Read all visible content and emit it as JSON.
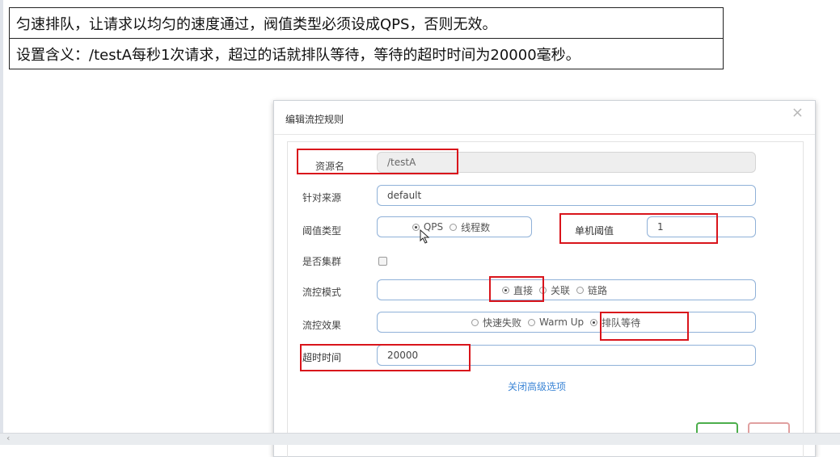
{
  "notes": [
    "匀速排队，让请求以均匀的速度通过，阀值类型必须设成QPS，否则无效。",
    "设置含义：/testA每秒1次请求，超过的话就排队等待，等待的超时时间为20000毫秒。"
  ],
  "dialog": {
    "title": "编辑流控规则",
    "close": "×",
    "resource_label": "资源名",
    "resource_value": "/testA",
    "source_label": "针对来源",
    "source_value": "default",
    "threshold_type_label": "阈值类型",
    "threshold_type_options": [
      "QPS",
      "线程数"
    ],
    "threshold_type_selected": "QPS",
    "single_threshold_label": "单机阈值",
    "single_threshold_value": "1",
    "cluster_label": "是否集群",
    "cluster_checked": false,
    "mode_label": "流控模式",
    "mode_options": [
      "直接",
      "关联",
      "链路"
    ],
    "mode_selected": "直接",
    "effect_label": "流控效果",
    "effect_options": [
      "快速失败",
      "Warm Up",
      "排队等待"
    ],
    "effect_selected": "排队等待",
    "timeout_label": "超时时间",
    "timeout_value": "20000",
    "advanced_link": "关闭高级选项"
  },
  "colors": {
    "highlight": "#d9141b",
    "link": "#3d86d6",
    "input_border": "#8fb1d8"
  }
}
